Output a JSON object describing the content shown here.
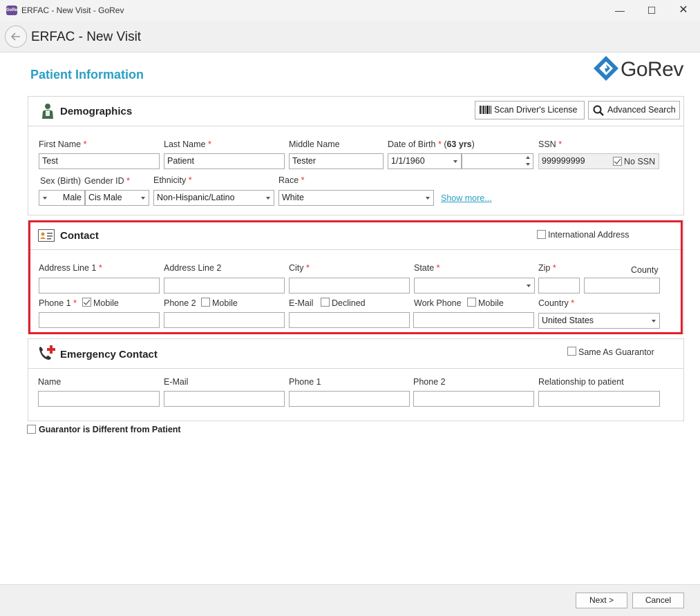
{
  "window": {
    "app_icon_text": "GoRev",
    "title": "ERFAC - New Visit - GoRev",
    "minimize": "—",
    "maximize": "☐",
    "close": "✕"
  },
  "header": {
    "title": "ERFAC - New Visit"
  },
  "page": {
    "section_title": "Patient Information",
    "logo_text": "GoRev"
  },
  "demographics": {
    "title": "Demographics",
    "scan_button": "Scan Driver's License",
    "search_button": "Advanced Search",
    "first_name": {
      "label": "First Name",
      "value": "Test"
    },
    "last_name": {
      "label": "Last Name",
      "value": "Patient"
    },
    "middle_name": {
      "label": "Middle Name",
      "value": "Tester"
    },
    "dob": {
      "label": "Date of Birth",
      "age": "63 yrs",
      "value": "1/1/1960",
      "time": ""
    },
    "ssn": {
      "label": "SSN",
      "value": "999999999",
      "no_ssn_label": "No SSN",
      "no_ssn_checked": true
    },
    "sex": {
      "label": "Sex (Birth)",
      "value": "Male"
    },
    "gender": {
      "label": "Gender ID",
      "value": "Cis Male"
    },
    "ethnicity": {
      "label": "Ethnicity",
      "value": "Non-Hispanic/Latino"
    },
    "race": {
      "label": "Race",
      "value": "White"
    },
    "show_more": "Show more..."
  },
  "contact": {
    "title": "Contact",
    "international_label": "International Address",
    "address1": {
      "label": "Address Line 1",
      "value": ""
    },
    "address2": {
      "label": "Address Line 2",
      "value": ""
    },
    "city": {
      "label": "City",
      "value": ""
    },
    "state": {
      "label": "State",
      "value": ""
    },
    "zip": {
      "label": "Zip",
      "value": ""
    },
    "county": {
      "label": "County",
      "value": ""
    },
    "phone1": {
      "label": "Phone 1",
      "mobile_label": "Mobile",
      "mobile_checked": true,
      "value": ""
    },
    "phone2": {
      "label": "Phone 2",
      "mobile_label": "Mobile",
      "mobile_checked": false,
      "value": ""
    },
    "email": {
      "label": "E-Mail",
      "declined_label": "Declined",
      "value": ""
    },
    "work_phone": {
      "label": "Work Phone",
      "mobile_label": "Mobile",
      "value": ""
    },
    "country": {
      "label": "Country",
      "value": "United States"
    }
  },
  "emergency": {
    "title": "Emergency Contact",
    "same_as_guarantor": "Same As Guarantor",
    "name_label": "Name",
    "email_label": "E-Mail",
    "phone1_label": "Phone 1",
    "phone2_label": "Phone 2",
    "relationship_label": "Relationship to patient"
  },
  "guarantor": {
    "label": "Guarantor is Different from Patient"
  },
  "footer": {
    "next": "Next >",
    "cancel": "Cancel"
  },
  "colors": {
    "accent": "#2a9fc4",
    "required": "#e0312f",
    "highlight": "#e0202e"
  }
}
